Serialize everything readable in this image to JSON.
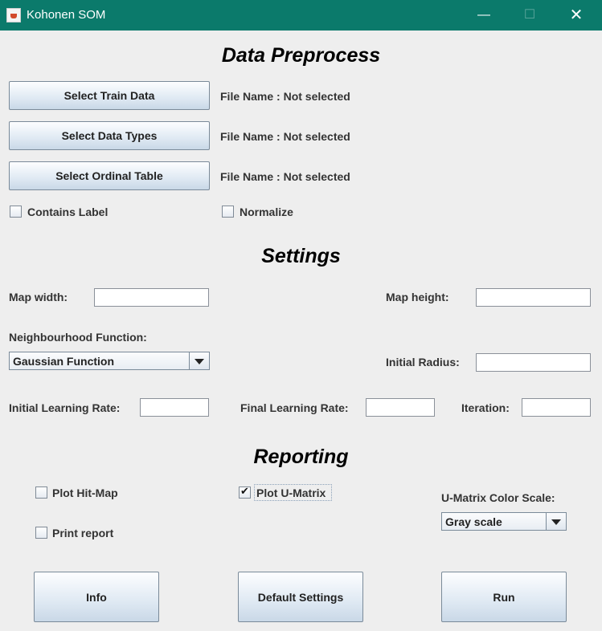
{
  "window": {
    "title": "Kohonen SOM",
    "controls": {
      "minimize": "—",
      "maximize": "☐",
      "close": "✕"
    }
  },
  "preprocess": {
    "title": "Data Preprocess",
    "select_train_label": "Select Train Data",
    "select_types_label": "Select Data Types",
    "select_ordinal_label": "Select Ordinal Table",
    "train_file": "File Name : Not selected",
    "types_file": "File Name : Not selected",
    "ordinal_file": "File Name : Not selected",
    "contains_label": "Contains Label",
    "contains_label_checked": false,
    "normalize": "Normalize",
    "normalize_checked": false
  },
  "settings": {
    "title": "Settings",
    "map_width_label": "Map width:",
    "map_width_value": "",
    "map_height_label": "Map height:",
    "map_height_value": "",
    "neighbourhood_label": "Neighbourhood Function:",
    "neighbourhood_value": "Gaussian Function",
    "initial_radius_label": "Initial Radius:",
    "initial_radius_value": "",
    "initial_lr_label": "Initial Learning Rate:",
    "initial_lr_value": "",
    "final_lr_label": "Final Learning Rate:",
    "final_lr_value": "",
    "iteration_label": "Iteration:",
    "iteration_value": ""
  },
  "reporting": {
    "title": "Reporting",
    "plot_hitmap": "Plot Hit-Map",
    "plot_hitmap_checked": false,
    "plot_umatrix": "Plot U-Matrix",
    "plot_umatrix_checked": true,
    "print_report": "Print report",
    "print_report_checked": false,
    "color_scale_label": "U-Matrix Color Scale:",
    "color_scale_value": "Gray scale"
  },
  "actions": {
    "info": "Info",
    "default_settings": "Default Settings",
    "run": "Run"
  },
  "colors": {
    "titlebar": "#0b7a6b",
    "background": "#eeeeee"
  }
}
